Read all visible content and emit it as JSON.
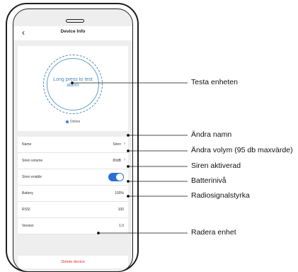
{
  "header": {
    "back_icon": "chevron-left-icon",
    "title": "Device Info"
  },
  "test_button": {
    "label": "Long press to test alarm"
  },
  "status": {
    "label": "Online",
    "dot_color": "#2f7fd6"
  },
  "settings": [
    {
      "label": "Name",
      "value": "Siren",
      "chevron": true
    },
    {
      "label": "Siren volume",
      "value": "80dB",
      "chevron": true
    },
    {
      "label": "Siren enable",
      "toggle_on": true
    },
    {
      "label": "Battery",
      "value": "100%"
    },
    {
      "label": "RSSI",
      "value": "100"
    },
    {
      "label": "Version",
      "value": "1.0"
    }
  ],
  "delete": {
    "label": "Delete device",
    "color": "#d9302c"
  },
  "annotations": {
    "test": "Testa enheten",
    "name": "Ändra namn",
    "volume": "Ändra volym (95 db maxvärde)",
    "siren": "Siren aktiverad",
    "battery": "Batterinivå",
    "rssi": "Radiosignalstyrka",
    "delete": "Radera enhet"
  }
}
